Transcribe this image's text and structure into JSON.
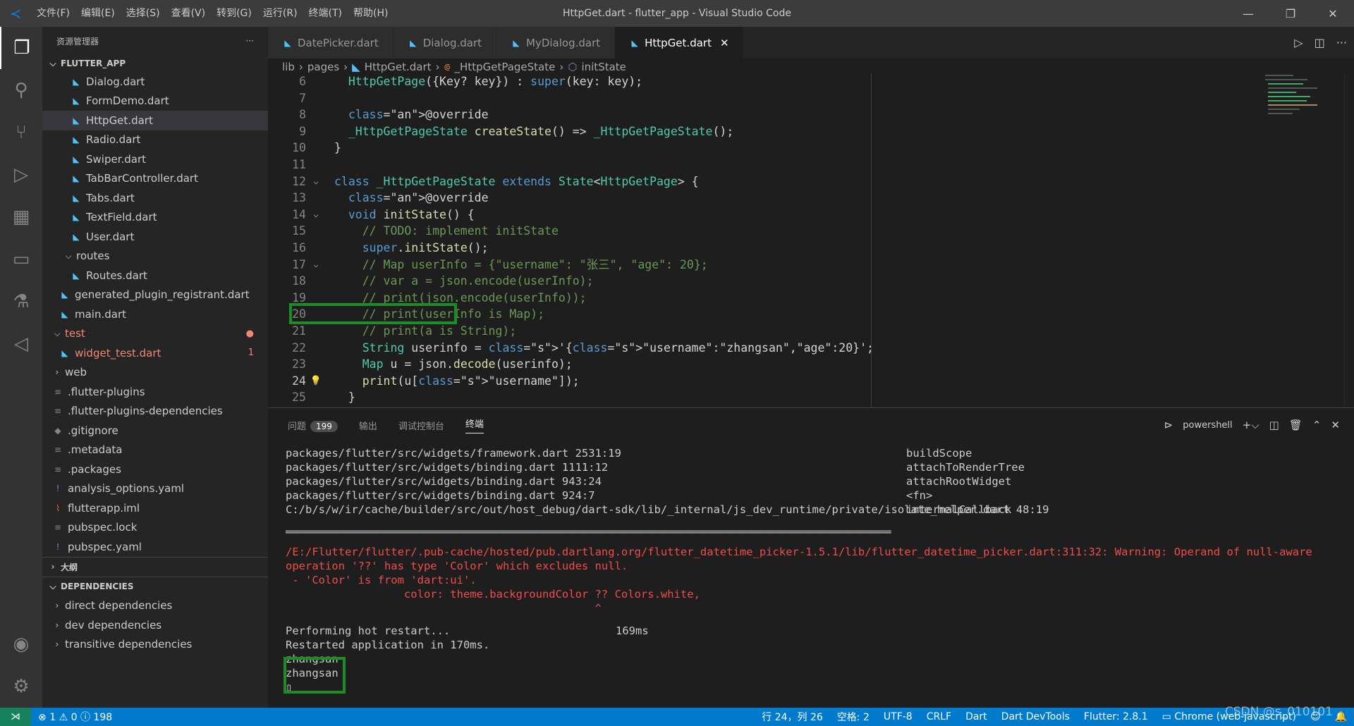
{
  "app": {
    "title": "HttpGet.dart - flutter_app - Visual Studio Code",
    "menu": [
      "文件(F)",
      "编辑(E)",
      "选择(S)",
      "查看(V)",
      "转到(G)",
      "运行(R)",
      "终端(T)",
      "帮助(H)"
    ]
  },
  "sidebar": {
    "header": "资源管理器",
    "more": "···",
    "section_project": "FLUTTER_APP",
    "items": [
      {
        "label": "Dialog.dart",
        "icon": "dart-file-icon"
      },
      {
        "label": "FormDemo.dart",
        "icon": "dart-file-icon"
      },
      {
        "label": "HttpGet.dart",
        "icon": "dart-file-icon"
      },
      {
        "label": "Radio.dart",
        "icon": "dart-file-icon"
      },
      {
        "label": "Swiper.dart",
        "icon": "dart-file-icon"
      },
      {
        "label": "TabBarController.dart",
        "icon": "dart-file-icon"
      },
      {
        "label": "Tabs.dart",
        "icon": "dart-file-icon"
      },
      {
        "label": "TextField.dart",
        "icon": "dart-file-icon"
      },
      {
        "label": "User.dart",
        "icon": "dart-file-icon"
      },
      {
        "label": "routes",
        "icon": "folder-icon"
      },
      {
        "label": "Routes.dart",
        "icon": "dart-file-icon"
      },
      {
        "label": "generated_plugin_registrant.dart",
        "icon": "dart-file-icon"
      },
      {
        "label": "main.dart",
        "icon": "dart-file-icon"
      },
      {
        "label": "test",
        "icon": "folder-icon"
      },
      {
        "label": "widget_test.dart",
        "icon": "dart-file-icon",
        "badge": "1"
      },
      {
        "label": "web",
        "icon": "folder-icon"
      },
      {
        "label": ".flutter-plugins",
        "icon": "text-file-icon"
      },
      {
        "label": ".flutter-plugins-dependencies",
        "icon": "text-file-icon"
      },
      {
        "label": ".gitignore",
        "icon": "git-file-icon"
      },
      {
        "label": ".metadata",
        "icon": "text-file-icon"
      },
      {
        "label": ".packages",
        "icon": "text-file-icon"
      },
      {
        "label": "analysis_options.yaml",
        "icon": "yaml-file-icon"
      },
      {
        "label": "flutterapp.iml",
        "icon": "rss-file-icon"
      },
      {
        "label": "pubspec.lock",
        "icon": "text-file-icon"
      },
      {
        "label": "pubspec.yaml",
        "icon": "yaml-file-icon"
      }
    ],
    "section_outline": "大纲",
    "section_deps": "DEPENDENCIES",
    "deps": [
      "direct dependencies",
      "dev dependencies",
      "transitive dependencies"
    ]
  },
  "tabs": [
    {
      "label": "DatePicker.dart"
    },
    {
      "label": "Dialog.dart"
    },
    {
      "label": "MyDialog.dart"
    },
    {
      "label": "HttpGet.dart",
      "active": true
    }
  ],
  "breadcrumb": [
    "lib",
    "pages",
    "HttpGet.dart",
    "_HttpGetPageState",
    "initState"
  ],
  "code": {
    "line_numbers": [
      "6",
      "7",
      "8",
      "9",
      "10",
      "11",
      "12",
      "13",
      "14",
      "15",
      "16",
      "17",
      "18",
      "19",
      "20",
      "21",
      "22",
      "23",
      "24",
      "25"
    ],
    "lines": [
      "  HttpGetPage({Key? key}) : super(key: key);",
      "",
      "  @override",
      "  _HttpGetPageState createState() => _HttpGetPageState();",
      "}",
      "",
      "class _HttpGetPageState extends State<HttpGetPage> {",
      "  @override",
      "  void initState() {",
      "    // TODO: implement initState",
      "    super.initState();",
      "    // Map userInfo = {\"username\": \"张三\", \"age\": 20};",
      "    // var a = json.encode(userInfo);",
      "    // print(json.encode(userInfo));",
      "    // print(userInfo is Map);",
      "    // print(a is String);",
      "    String userinfo = '{\"username\":\"zhangsan\",\"age\":20}';",
      "    Map u = json.decode(userinfo);",
      "    print(u[\"username\"]);",
      "  }"
    ],
    "current_line": "24"
  },
  "panel": {
    "tabs": [
      "问题",
      "输出",
      "调试控制台",
      "终端"
    ],
    "problems_count": "199",
    "shell": "powershell",
    "terminal_left": [
      "packages/flutter/src/widgets/framework.dart 2531:19",
      "packages/flutter/src/widgets/binding.dart 1111:12",
      "packages/flutter/src/widgets/binding.dart 943:24",
      "packages/flutter/src/widgets/binding.dart 924:7",
      "C:/b/s/w/ir/cache/builder/src/out/host_debug/dart-sdk/lib/_internal/js_dev_runtime/private/isolate_helper.dart 48:19"
    ],
    "terminal_right": [
      "buildScope",
      "attachToRenderTree",
      "attachRootWidget",
      "<fn>",
      "internalCallback"
    ],
    "separator": "════════════════════════════════════════════════════════════════════════════════════════════",
    "warning_lines": [
      "/E:/Flutter/flutter/.pub-cache/hosted/pub.dartlang.org/flutter_datetime_picker-1.5.1/lib/flutter_datetime_picker.dart:311:32: Warning: Operand of null-aware",
      "operation '??' has type 'Color' which excludes null.",
      " - 'Color' is from 'dart:ui'.",
      "                  color: theme.backgroundColor ?? Colors.white,",
      "                                               ^"
    ],
    "restart_line": "Performing hot restart...",
    "restart_time": "169ms",
    "restarted_line": "Restarted application in 170ms.",
    "output": [
      "zhangsan",
      "zhangsan"
    ]
  },
  "statusbar": {
    "errors": "1",
    "warnings": "0",
    "infos": "198",
    "position": "行 24，列 26",
    "spaces": "空格: 2",
    "encoding": "UTF-8",
    "eol": "CRLF",
    "language": "Dart",
    "devtools": "Dart DevTools",
    "flutter": "Flutter: 2.8.1",
    "device": "Chrome (web-javascript)"
  },
  "watermark": "CSDN @s_010101"
}
